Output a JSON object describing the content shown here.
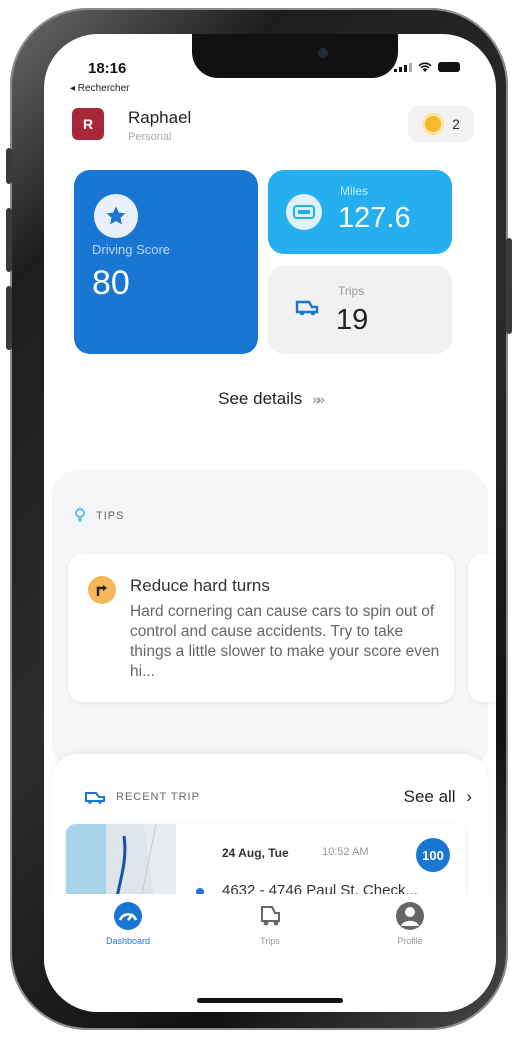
{
  "status_bar": {
    "time": "18:16",
    "back_label": "◂ Rechercher"
  },
  "header": {
    "avatar_letter": "R",
    "user_name": "Raphael",
    "user_subtitle": "Personal",
    "coins": "2"
  },
  "stats": {
    "driving_score": {
      "label": "Driving Score",
      "value": "80",
      "icon": "star-icon"
    },
    "miles": {
      "label": "Miles",
      "value": "127.6",
      "icon": "odometer-icon"
    },
    "trips": {
      "label": "Trips",
      "value": "19",
      "icon": "car-icon"
    }
  },
  "see_details": {
    "label": "See details",
    "chevron": "»»"
  },
  "tips": {
    "title": "TIPS",
    "items": [
      {
        "title": "Reduce hard turns",
        "body": "Hard cornering can cause cars to spin out of control and cause accidents. Try to take things a little slower to make your score even hi..."
      }
    ]
  },
  "recent_trip": {
    "title": "RECENT TRIP",
    "see_all": "See all",
    "see_all_chevron": "›",
    "trip": {
      "date": "24 Aug, Tue",
      "time": "10:52 AM",
      "score": "100",
      "address": "4632 - 4746 Paul St, Check..."
    }
  },
  "tabs": [
    {
      "label": "Dashboard",
      "icon": "gauge-icon",
      "active": true
    },
    {
      "label": "Trips",
      "icon": "car-icon",
      "active": false
    },
    {
      "label": "Profile",
      "icon": "person-icon",
      "active": false
    }
  ],
  "colors": {
    "primary": "#1976d2",
    "miles_blue": "#25aef0",
    "avatar_red": "#a8283a",
    "coin_yellow": "#f5b82e",
    "tip_orange": "#f5b75a"
  }
}
